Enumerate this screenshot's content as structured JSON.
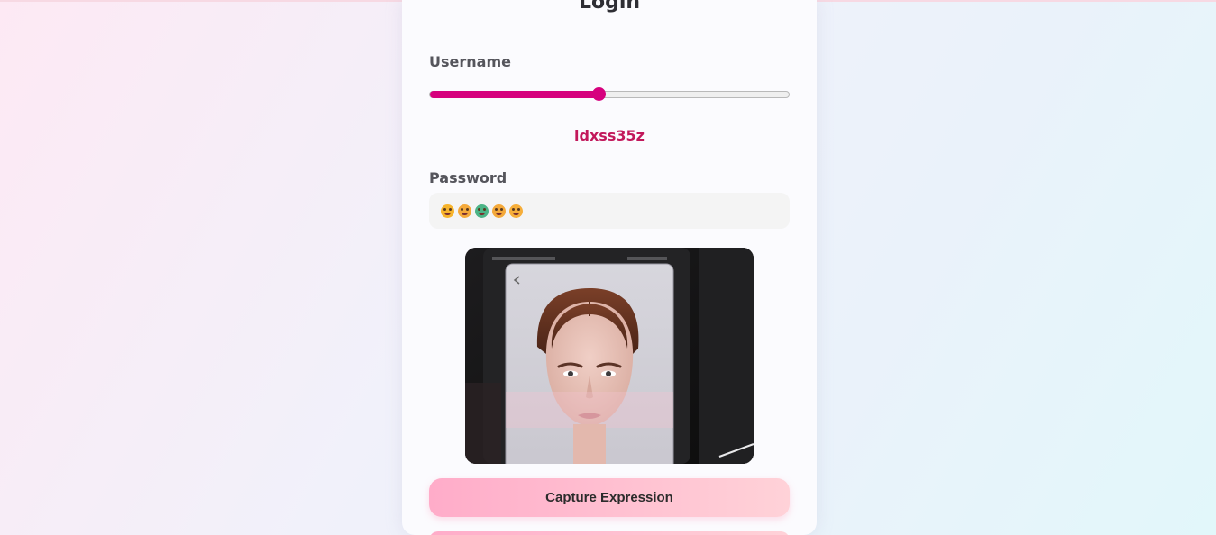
{
  "login": {
    "title": "Login",
    "username_label": "Username",
    "username_slider_fraction": 0.47,
    "username_value": "ldxss35z",
    "password_label": "Password",
    "password_emojis": [
      {
        "name": "grin-tongue-emoji",
        "color": "#f7b42c"
      },
      {
        "name": "grimace-emoji",
        "color": "#f4a93a"
      },
      {
        "name": "nauseated-emoji",
        "color": "#4cb486"
      },
      {
        "name": "worried-emoji",
        "color": "#f4a93a"
      },
      {
        "name": "smile-emoji",
        "color": "#f6ae3a"
      }
    ],
    "capture_button_label": "Capture Expression"
  },
  "colors": {
    "accent": "#d6017e",
    "username_text": "#c2185b",
    "button_gradient_start": "#ffacc9",
    "button_gradient_end": "#ffd2d8"
  }
}
